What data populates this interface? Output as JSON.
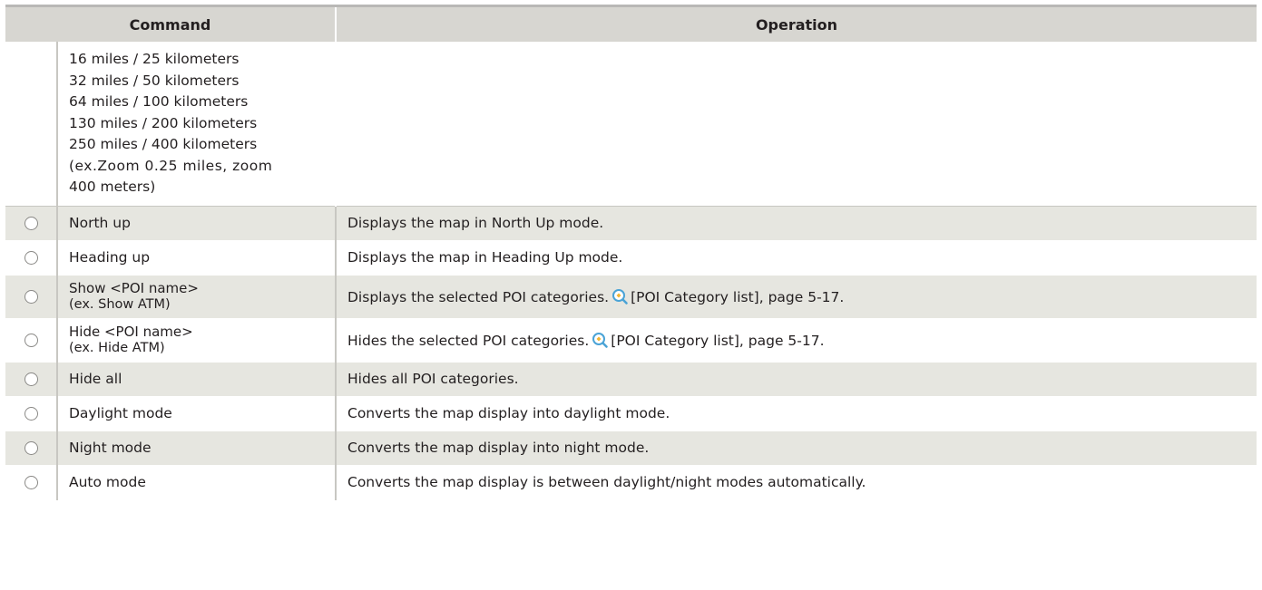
{
  "header": {
    "command": "Command",
    "operation": "Operation"
  },
  "first_row": {
    "lines": [
      "16 miles / 25 kilometers",
      "32 miles / 50 kilometers",
      "64 miles / 100 kilometers",
      "130 miles / 200 kilometers",
      "250 miles / 400 kilometers",
      "(ex.Zoom 0.25 miles, zoom",
      "400 meters)"
    ]
  },
  "rows": [
    {
      "command": "North up",
      "command2": "",
      "operation": "Displays the map in North Up mode.",
      "ref": "",
      "tail": ""
    },
    {
      "command": "Heading up",
      "command2": "",
      "operation": "Displays the map in Heading Up mode.",
      "ref": "",
      "tail": ""
    },
    {
      "command": "Show <POI name>",
      "command2": "(ex. Show ATM)",
      "operation": "Displays the selected POI categories.",
      "ref": "[POI Category list]",
      "tail": ", page 5-17."
    },
    {
      "command": "Hide <POI name>",
      "command2": "(ex. Hide ATM)",
      "operation": "Hides the selected POI categories.",
      "ref": "[POI Category list]",
      "tail": ", page 5-17."
    },
    {
      "command": "Hide all",
      "command2": "",
      "operation": "Hides all POI categories.",
      "ref": "",
      "tail": ""
    },
    {
      "command": "Daylight mode",
      "command2": "",
      "operation": "Converts the map display into daylight mode.",
      "ref": "",
      "tail": ""
    },
    {
      "command": "Night mode",
      "command2": "",
      "operation": "Converts the map display into night mode.",
      "ref": "",
      "tail": ""
    },
    {
      "command": "Auto mode",
      "command2": "",
      "operation": "Converts the map display is between daylight/night modes automatically.",
      "ref": "",
      "tail": ""
    }
  ],
  "icons": {
    "row_marker": "circle-icon",
    "reference": "magnifier-icon"
  },
  "colors": {
    "header_bg": "#d7d6d1",
    "shaded_row_bg": "#e6e6e0",
    "text": "#231f20",
    "reference_icon": "#4aa3d6"
  }
}
